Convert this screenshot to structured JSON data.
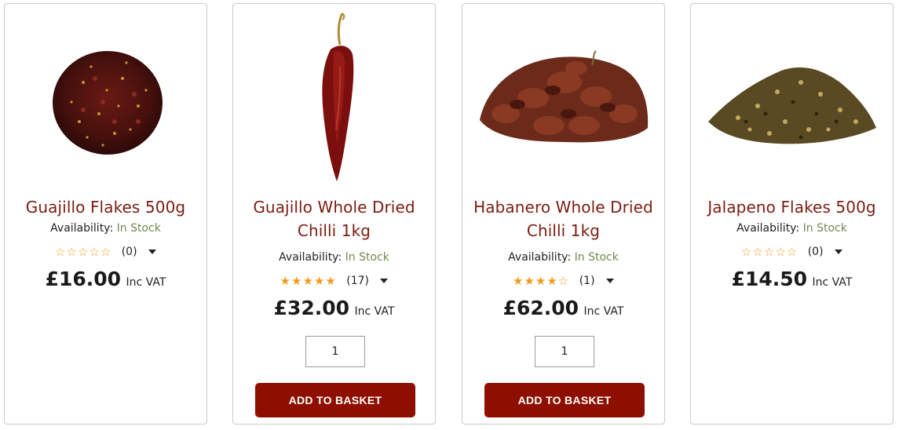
{
  "products": [
    {
      "name": "Guajillo Flakes 500g",
      "availability_label": "Availability:",
      "availability_value": "In Stock",
      "rating_count": "(0)",
      "stars_filled": 0,
      "price": "£16.00",
      "price_suffix": "Inc VAT"
    },
    {
      "name": "Guajillo Whole Dried Chilli 1kg",
      "availability_label": "Availability:",
      "availability_value": "In Stock",
      "rating_count": "(17)",
      "stars_filled": 5,
      "price": "£32.00",
      "price_suffix": "Inc VAT",
      "quantity": "1",
      "button_label": "ADD TO BASKET"
    },
    {
      "name": "Habanero Whole Dried Chilli 1kg",
      "availability_label": "Availability:",
      "availability_value": "In Stock",
      "rating_count": "(1)",
      "stars_filled": 4,
      "price": "£62.00",
      "price_suffix": "Inc VAT",
      "quantity": "1",
      "button_label": "ADD TO BASKET"
    },
    {
      "name": "Jalapeno Flakes 500g",
      "availability_label": "Availability:",
      "availability_value": "In Stock",
      "rating_count": "(0)",
      "stars_filled": 0,
      "price": "£14.50",
      "price_suffix": "Inc VAT"
    }
  ],
  "colors": {
    "title": "#7b1c10",
    "in_stock": "#6f8a4e",
    "star": "#f29a1a",
    "button": "#8e0f00"
  }
}
